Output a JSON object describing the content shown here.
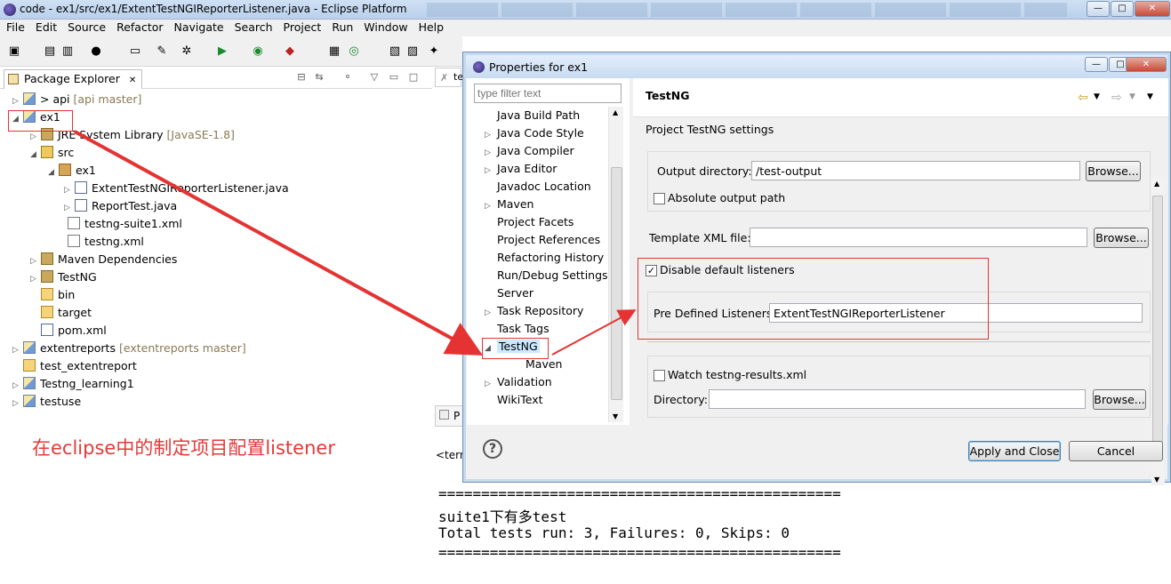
{
  "window": {
    "title": "code - ex1/src/ex1/ExtentTestNGIReporterListener.java - Eclipse Platform",
    "controls": {
      "minimize": "—",
      "maximize": "□",
      "close": "✕"
    }
  },
  "menu": [
    "File",
    "Edit",
    "Source",
    "Refactor",
    "Navigate",
    "Search",
    "Project",
    "Run",
    "Window",
    "Help"
  ],
  "package_explorer": {
    "tab_label": "Package Explorer",
    "tab_close": "✕",
    "tree": [
      {
        "label": "> api",
        "decoration": "[api master]",
        "twisty": "▷",
        "icon": "proj"
      },
      {
        "label": "ex1",
        "decoration": "",
        "twisty": "◢",
        "icon": "proj"
      },
      {
        "label": "JRE System Library",
        "decoration": "[JavaSE-1.8]",
        "twisty": "▷",
        "icon": "lib"
      },
      {
        "label": "src",
        "decoration": "",
        "twisty": "◢",
        "icon": "srcf"
      },
      {
        "label": "ex1",
        "decoration": "",
        "twisty": "◢",
        "icon": "pkg"
      },
      {
        "label": "ExtentTestNGIReporterListener.java",
        "decoration": "",
        "twisty": "▷",
        "icon": "java"
      },
      {
        "label": "ReportTest.java",
        "decoration": "",
        "twisty": "▷",
        "icon": "java"
      },
      {
        "label": "testng-suite1.xml",
        "decoration": "",
        "twisty": "",
        "icon": "xml"
      },
      {
        "label": "testng.xml",
        "decoration": "",
        "twisty": "",
        "icon": "xml"
      },
      {
        "label": "Maven Dependencies",
        "decoration": "",
        "twisty": "▷",
        "icon": "lib"
      },
      {
        "label": "TestNG",
        "decoration": "",
        "twisty": "▷",
        "icon": "lib"
      },
      {
        "label": "bin",
        "decoration": "",
        "twisty": "",
        "icon": "fold"
      },
      {
        "label": "target",
        "decoration": "",
        "twisty": "",
        "icon": "fold"
      },
      {
        "label": "pom.xml",
        "decoration": "",
        "twisty": "",
        "icon": "pom"
      },
      {
        "label": "extentreports",
        "decoration": "[extentreports master]",
        "twisty": "▷",
        "icon": "proj"
      },
      {
        "label": "test_extentreport",
        "decoration": "",
        "twisty": "",
        "icon": "fold"
      },
      {
        "label": "Testng_learning1",
        "decoration": "",
        "twisty": "▷",
        "icon": "proj"
      },
      {
        "label": "testuse",
        "decoration": "",
        "twisty": "▷",
        "icon": "proj"
      }
    ]
  },
  "annotation": "在eclipse中的制定项目配置listener",
  "console": {
    "tab_label": "P",
    "terminated": "<tern",
    "lines": [
      "===============================================",
      "suite1下有多test",
      "Total tests run: 3, Failures: 0, Skips: 0",
      "==============================================="
    ]
  },
  "editor_tab_label": "te",
  "dialog": {
    "title": "Properties for ex1",
    "filter_placeholder": "type filter text",
    "nav": [
      {
        "label": "Java Build Path",
        "twisty": ""
      },
      {
        "label": "Java Code Style",
        "twisty": "▷"
      },
      {
        "label": "Java Compiler",
        "twisty": "▷"
      },
      {
        "label": "Java Editor",
        "twisty": "▷"
      },
      {
        "label": "Javadoc Location",
        "twisty": ""
      },
      {
        "label": "Maven",
        "twisty": "▷"
      },
      {
        "label": "Project Facets",
        "twisty": ""
      },
      {
        "label": "Project References",
        "twisty": ""
      },
      {
        "label": "Refactoring History",
        "twisty": ""
      },
      {
        "label": "Run/Debug Settings",
        "twisty": ""
      },
      {
        "label": "Server",
        "twisty": ""
      },
      {
        "label": "Task Repository",
        "twisty": "▷"
      },
      {
        "label": "Task Tags",
        "twisty": ""
      },
      {
        "label": "TestNG",
        "twisty": "◢",
        "selected": true
      },
      {
        "label": "Maven",
        "twisty": "",
        "child": true
      },
      {
        "label": "Validation",
        "twisty": "▷"
      },
      {
        "label": "WikiText",
        "twisty": ""
      }
    ],
    "page": {
      "title": "TestNG",
      "subtitle": "Project TestNG settings",
      "output_directory_label": "Output directory:",
      "output_directory_value": "/test-output",
      "browse_label": "Browse...",
      "absolute_output_label": "Absolute output path",
      "absolute_output_checked": false,
      "template_xml_label": "Template XML file:",
      "template_xml_value": "",
      "disable_default_label": "Disable default listeners",
      "disable_default_checked": true,
      "predefined_label": "Pre Defined Listeners:",
      "predefined_value": "ExtentTestNGIReporterListener",
      "watch_results_label": "Watch testng-results.xml",
      "watch_results_checked": false,
      "directory_label": "Directory:",
      "directory_value": ""
    },
    "buttons": {
      "apply_close": "Apply and Close",
      "cancel": "Cancel",
      "help": "?"
    }
  },
  "colors": {
    "annotation_red": "#e43a3a",
    "selection": "#cce8ff",
    "accent": "#3c7fb1"
  }
}
